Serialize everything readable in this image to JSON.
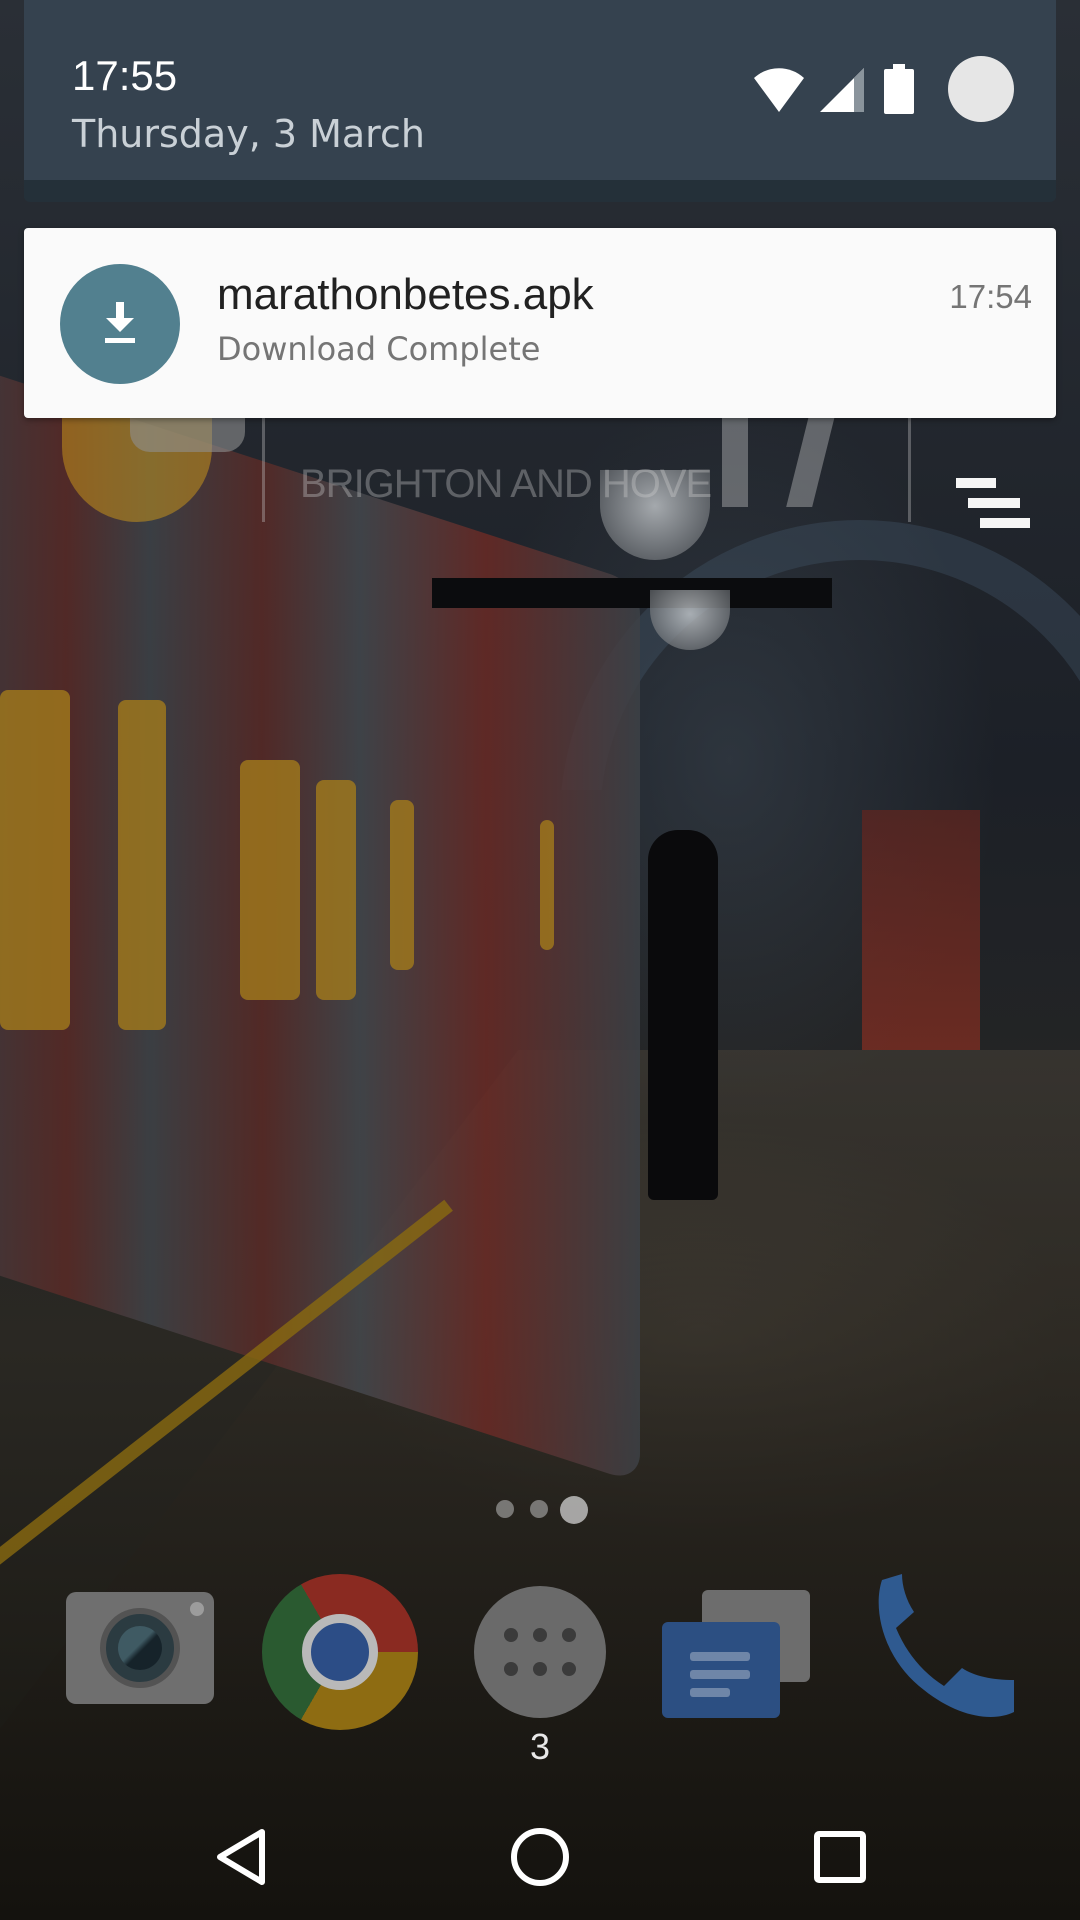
{
  "status_shade": {
    "time": "17:55",
    "date": "Thursday, 3 March",
    "icons": [
      "wifi-icon",
      "cellular-signal-icon",
      "battery-icon",
      "user-avatar-icon"
    ]
  },
  "notification": {
    "icon": "download-icon",
    "title": "marathonbetes.apk",
    "text": "Download Complete",
    "time": "17:54",
    "icon_color": "#52808f"
  },
  "home": {
    "widget": {
      "location": "BRIGHTON AND HOVE",
      "icons": [
        "weather-icon",
        "menu-icon"
      ]
    },
    "page_indicator": {
      "pages": 3,
      "active_page": 3
    },
    "dock": {
      "apps": [
        "camera-icon",
        "chrome-icon",
        "app-drawer-icon",
        "messages-icon",
        "phone-icon"
      ],
      "badge": "3"
    }
  },
  "nav_bar": {
    "buttons": [
      "back-icon",
      "home-icon",
      "recents-icon"
    ]
  },
  "colors": {
    "shade_header": "#35424f",
    "card_background": "#fafafa"
  }
}
